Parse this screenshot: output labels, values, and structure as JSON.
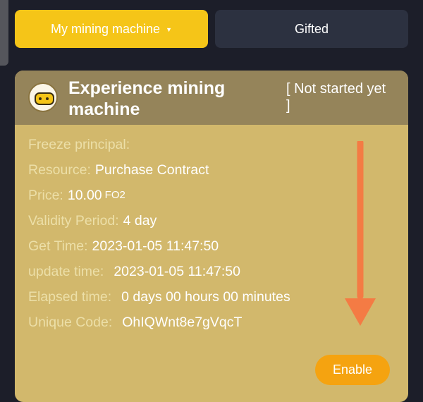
{
  "tabs": {
    "my_machine": "My mining machine",
    "gifted": "Gifted"
  },
  "card": {
    "title": "Experience mining machine",
    "status_open": "[ Not started yet",
    "status_close": "]",
    "rows": [
      {
        "label": "Freeze principal:",
        "value": "",
        "unit": ""
      },
      {
        "label": "Resource:",
        "value": "Purchase Contract",
        "unit": ""
      },
      {
        "label": "Price:",
        "value": "10.00",
        "unit": "FO2"
      },
      {
        "label": "Validity Period:",
        "value": "4 day",
        "unit": ""
      },
      {
        "label": "Get Time:",
        "value": "2023-01-05 11:47:50",
        "unit": ""
      },
      {
        "label": "update time:",
        "value": "2023-01-05 11:47:50",
        "unit": ""
      },
      {
        "label": "Elapsed time:",
        "value": "0 days 00 hours 00 minutes",
        "unit": ""
      },
      {
        "label": "Unique Code:",
        "value": "OhIQWnt8e7gVqcT",
        "unit": ""
      }
    ],
    "enable_label": "Enable"
  },
  "colors": {
    "accent": "#f5c518",
    "button": "#f5a310",
    "arrow": "#f47b44",
    "card_body": "#d2b86c",
    "card_header": "#95845a"
  }
}
